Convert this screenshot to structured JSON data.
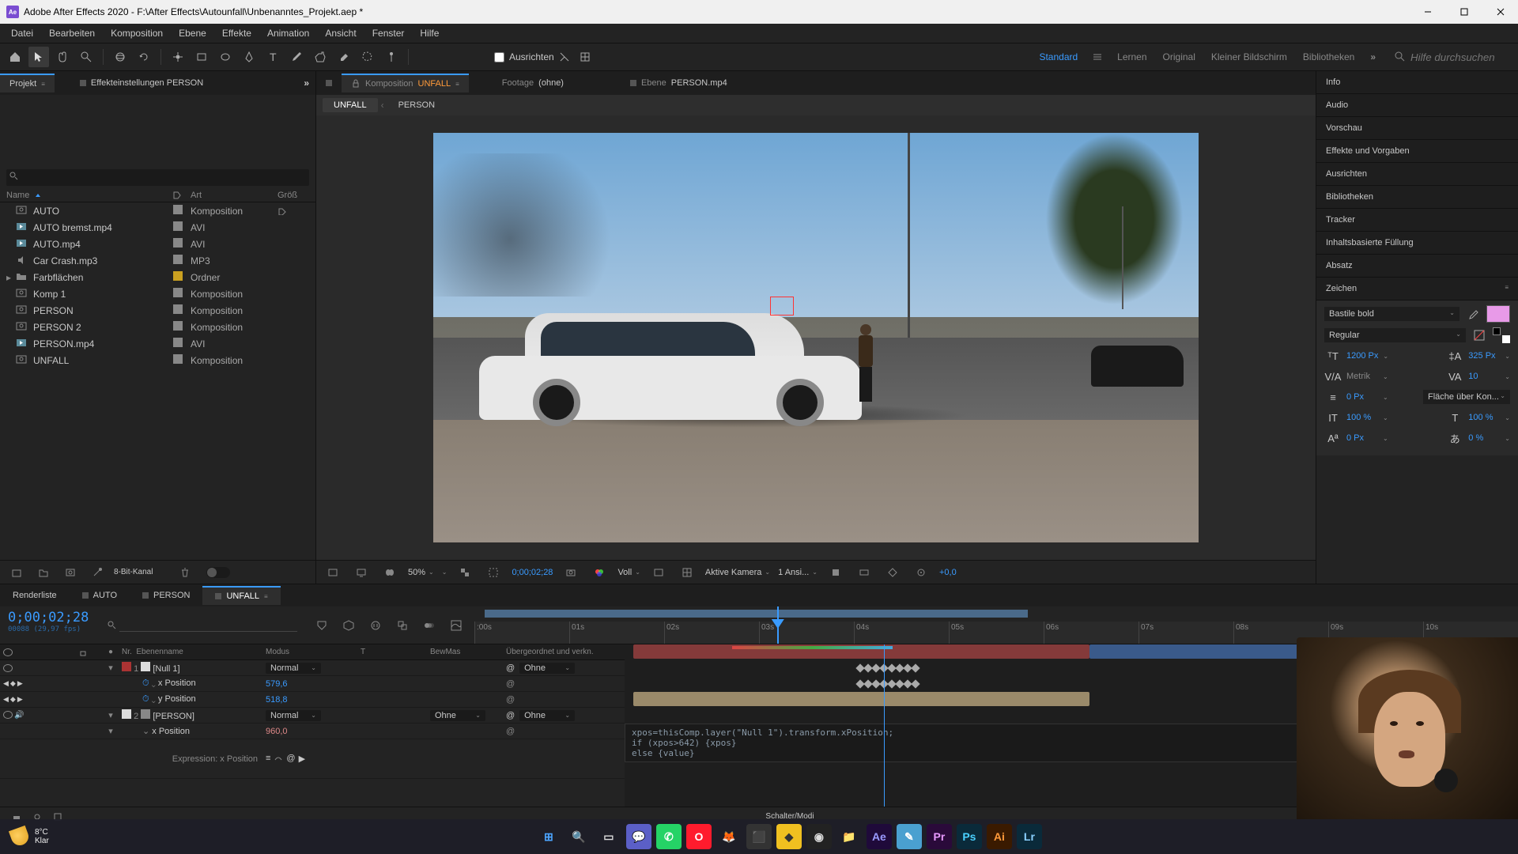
{
  "titlebar": {
    "app_icon": "Ae",
    "title": "Adobe After Effects 2020 - F:\\After Effects\\Autounfall\\Unbenanntes_Projekt.aep *"
  },
  "menubar": [
    "Datei",
    "Bearbeiten",
    "Komposition",
    "Ebene",
    "Effekte",
    "Animation",
    "Ansicht",
    "Fenster",
    "Hilfe"
  ],
  "toolbar": {
    "align": "Ausrichten",
    "workspaces": [
      "Standard",
      "Lernen",
      "Original",
      "Kleiner Bildschirm",
      "Bibliotheken"
    ],
    "active_workspace": "Standard",
    "search_placeholder": "Hilfe durchsuchen"
  },
  "project_panel": {
    "title": "Projekt",
    "effects_tab": "Effekteinstellungen PERSON",
    "columns": {
      "name": "Name",
      "type": "Art",
      "size": "Größ"
    },
    "items": [
      {
        "name": "AUTO",
        "type": "Komposition",
        "icon": "comp",
        "label": "#888"
      },
      {
        "name": "AUTO bremst.mp4",
        "type": "AVI",
        "icon": "video",
        "label": "#888"
      },
      {
        "name": "AUTO.mp4",
        "type": "AVI",
        "icon": "video",
        "label": "#888"
      },
      {
        "name": "Car Crash.mp3",
        "type": "MP3",
        "icon": "audio",
        "label": "#888"
      },
      {
        "name": "Farbflächen",
        "type": "Ordner",
        "icon": "folder",
        "label": "#caa020"
      },
      {
        "name": "Komp 1",
        "type": "Komposition",
        "icon": "comp",
        "label": "#888"
      },
      {
        "name": "PERSON",
        "type": "Komposition",
        "icon": "comp",
        "label": "#888"
      },
      {
        "name": "PERSON 2",
        "type": "Komposition",
        "icon": "comp",
        "label": "#888"
      },
      {
        "name": "PERSON.mp4",
        "type": "AVI",
        "icon": "video",
        "label": "#888"
      },
      {
        "name": "UNFALL",
        "type": "Komposition",
        "icon": "comp",
        "label": "#888"
      }
    ],
    "footer_bpc": "8-Bit-Kanal"
  },
  "comp_panel": {
    "tabs": [
      {
        "label_prefix": "Komposition",
        "label": "UNFALL",
        "active": true
      },
      {
        "label_prefix": "Footage",
        "label": "(ohne)",
        "active": false
      },
      {
        "label_prefix": "Ebene",
        "label": "PERSON.mp4",
        "active": false
      }
    ],
    "subtabs": [
      "UNFALL",
      "PERSON"
    ],
    "active_subtab": "UNFALL",
    "footer": {
      "zoom": "50%",
      "timecode": "0;00;02;28",
      "res": "Voll",
      "camera": "Aktive Kamera",
      "views": "1 Ansi...",
      "exposure": "+0,0"
    }
  },
  "right_panels": {
    "tabs": [
      "Info",
      "Audio",
      "Vorschau",
      "Effekte und Vorgaben",
      "Ausrichten",
      "Bibliotheken",
      "Tracker",
      "Inhaltsbasierte Füllung",
      "Absatz"
    ],
    "zeichen": {
      "title": "Zeichen",
      "font": "Bastile bold",
      "style": "Regular",
      "fill": "#e89ae8",
      "size": "1200 Px",
      "leading": "325 Px",
      "kerning": "Metrik",
      "tracking": "10",
      "stroke": "0 Px",
      "stroke_type": "Fläche über Kon...",
      "vscale": "100 %",
      "hscale": "100 %",
      "baseline": "0 Px",
      "tsume": "0 %"
    }
  },
  "timeline": {
    "tabs": [
      "Renderliste",
      "AUTO",
      "PERSON",
      "UNFALL"
    ],
    "active_tab": "UNFALL",
    "timecode": "0;00;02;28",
    "framecode": "00088 (29,97 fps)",
    "ruler_ticks": [
      ":00s",
      "01s",
      "02s",
      "03s",
      "04s",
      "05s",
      "06s",
      "07s",
      "08s",
      "09s",
      "10s"
    ],
    "playhead_pct": 29,
    "workarea_end_pct": 52,
    "columns": {
      "nr": "Nr.",
      "name": "Ebenenname",
      "mode": "Modus",
      "t": "T",
      "trkmat": "BewMas",
      "parent": "Übergeordnet und verkn."
    },
    "layers": [
      {
        "num": "1",
        "color": "#aa3333",
        "name": "[Null 1]",
        "mode": "Normal",
        "trkmat": "",
        "parent": "Ohne",
        "bar_color": "#843a3a",
        "props": [
          {
            "name": "x Position",
            "value": "579,6",
            "kf": true,
            "val_class": "blue"
          },
          {
            "name": "y Position",
            "value": "518,8",
            "kf": true,
            "val_class": "blue"
          }
        ]
      },
      {
        "num": "2",
        "color": "#dddddd",
        "name": "[PERSON]",
        "mode": "Normal",
        "trkmat": "Ohne",
        "parent": "Ohne",
        "bar_color": "#9a8a6a",
        "props": [
          {
            "name": "x Position",
            "value": "960,0",
            "kf": false,
            "expression": true,
            "val_class": "red",
            "expr_label": "Expression: x Position"
          }
        ]
      }
    ],
    "expression_text": "xpos=thisComp.layer(\"Null 1\").transform.xPosition;\nif (xpos>642) {xpos}\nelse {value}",
    "footer_toggle": "Schalter/Modi"
  },
  "taskbar": {
    "weather": {
      "temp": "8°C",
      "desc": "Klar"
    },
    "icons": [
      {
        "name": "windows-start",
        "glyph": "⊞",
        "bg": "transparent",
        "color": "#4ca5ff"
      },
      {
        "name": "search",
        "glyph": "🔍",
        "bg": "transparent",
        "color": "#ddd"
      },
      {
        "name": "task-view",
        "glyph": "▭",
        "bg": "transparent",
        "color": "#ddd"
      },
      {
        "name": "teams",
        "glyph": "💬",
        "bg": "#5b5fc7",
        "color": "#fff"
      },
      {
        "name": "whatsapp",
        "glyph": "✆",
        "bg": "#25d366",
        "color": "#fff"
      },
      {
        "name": "opera",
        "glyph": "O",
        "bg": "#ff1b2d",
        "color": "#fff"
      },
      {
        "name": "firefox",
        "glyph": "🦊",
        "bg": "transparent",
        "color": ""
      },
      {
        "name": "app1",
        "glyph": "⬛",
        "bg": "#333",
        "color": "#fff"
      },
      {
        "name": "app2",
        "glyph": "◆",
        "bg": "#f0c020",
        "color": "#333"
      },
      {
        "name": "obs",
        "glyph": "◉",
        "bg": "#222",
        "color": "#ddd"
      },
      {
        "name": "explorer",
        "glyph": "📁",
        "bg": "transparent",
        "color": ""
      },
      {
        "name": "after-effects",
        "glyph": "Ae",
        "bg": "#1f0a3a",
        "color": "#9a9aff"
      },
      {
        "name": "app3",
        "glyph": "✎",
        "bg": "#4aa0d0",
        "color": "#fff"
      },
      {
        "name": "premiere",
        "glyph": "Pr",
        "bg": "#2a0a3a",
        "color": "#e89aff"
      },
      {
        "name": "photoshop",
        "glyph": "Ps",
        "bg": "#0a2a3a",
        "color": "#4ad0ff"
      },
      {
        "name": "illustrator",
        "glyph": "Ai",
        "bg": "#3a1a00",
        "color": "#ff9a3a"
      },
      {
        "name": "lightroom",
        "glyph": "Lr",
        "bg": "#0a2a3a",
        "color": "#8ad0ff"
      }
    ]
  }
}
